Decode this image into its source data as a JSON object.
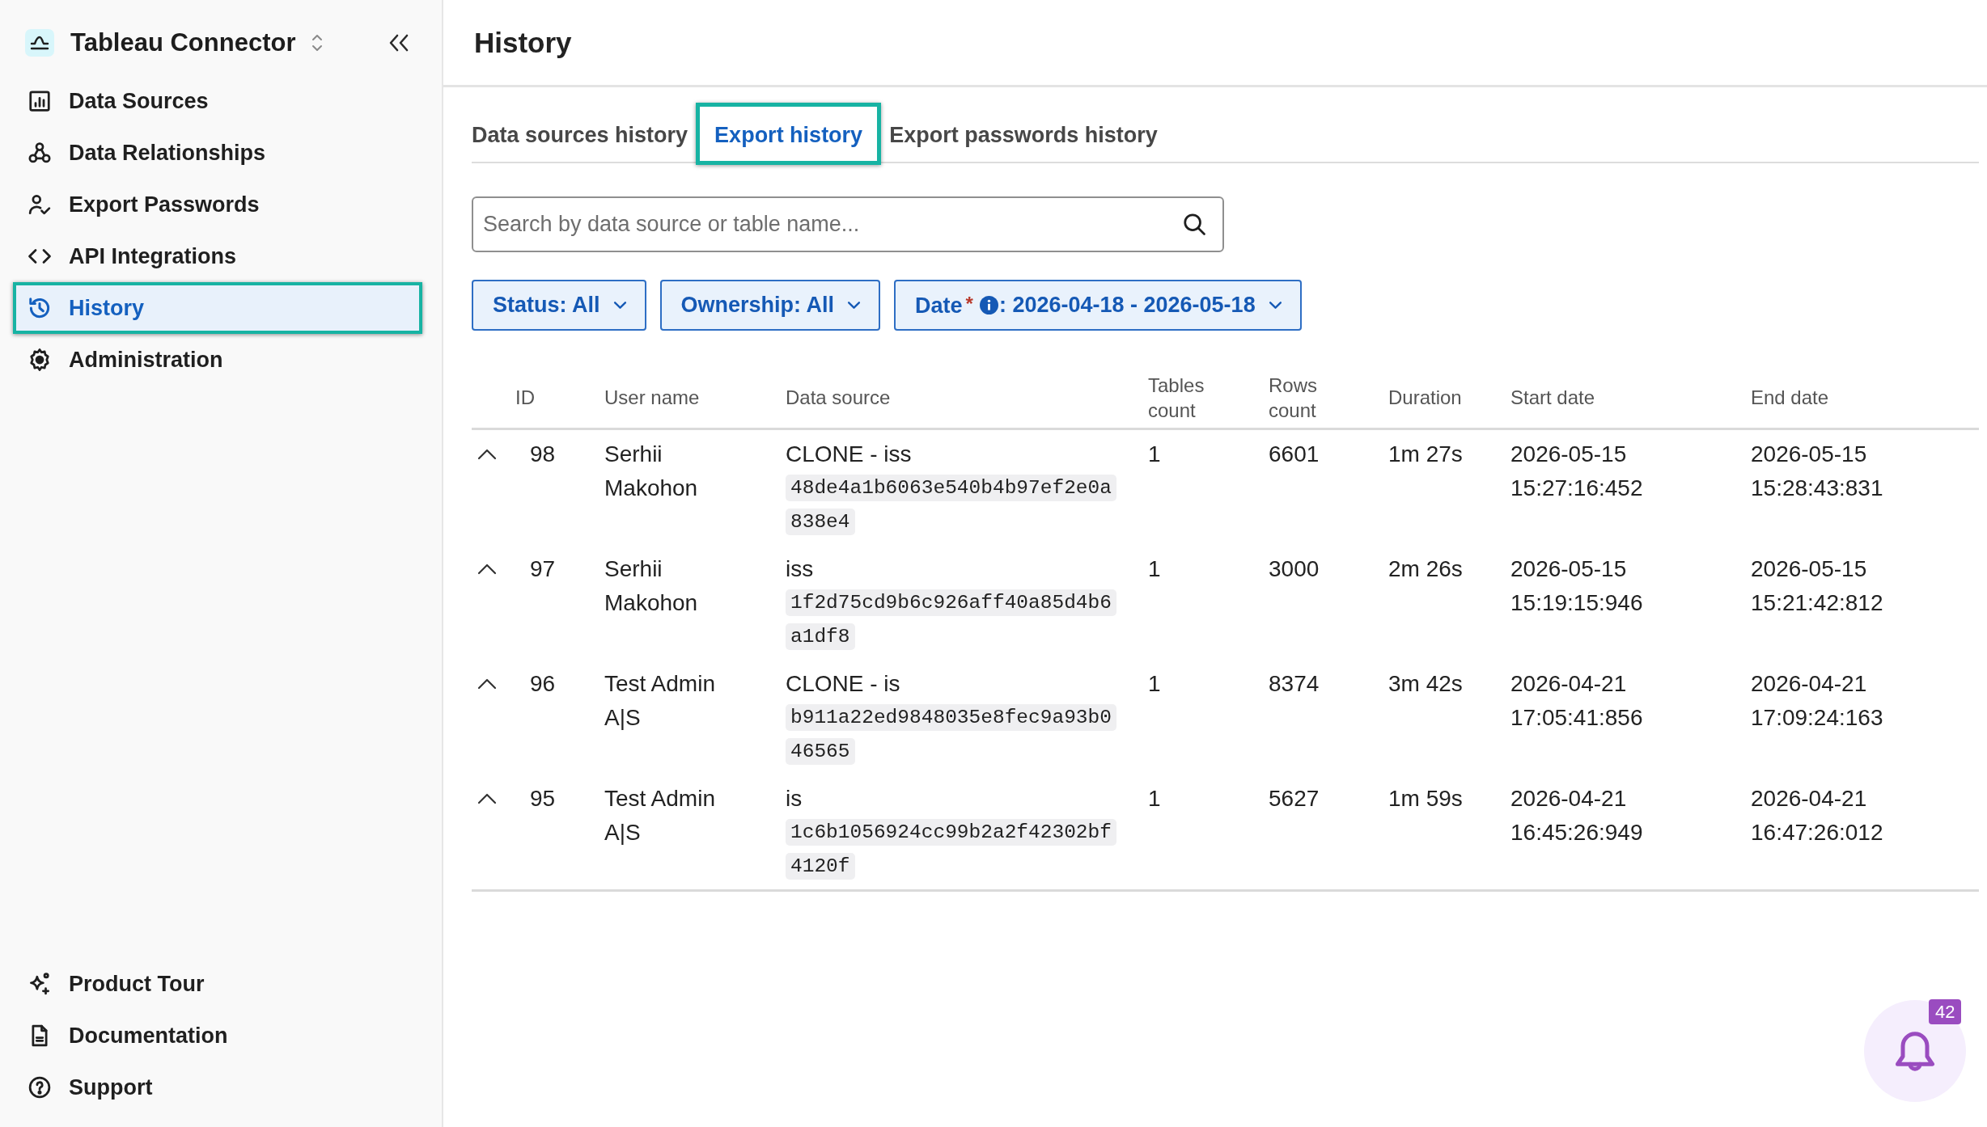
{
  "sidebar": {
    "title": "Tableau Connector",
    "nav": [
      {
        "label": "Data Sources",
        "selected": false
      },
      {
        "label": "Data Relationships",
        "selected": false
      },
      {
        "label": "Export Passwords",
        "selected": false
      },
      {
        "label": "API Integrations",
        "selected": false
      },
      {
        "label": "History",
        "selected": true
      },
      {
        "label": "Administration",
        "selected": false
      }
    ],
    "footer": [
      "Product Tour",
      "Documentation",
      "Support"
    ]
  },
  "page": {
    "title": "History"
  },
  "tabs": [
    {
      "label": "Data sources history",
      "selected": false
    },
    {
      "label": "Export history",
      "selected": true
    },
    {
      "label": "Export passwords history",
      "selected": false
    }
  ],
  "search": {
    "placeholder": "Search by data source or table name..."
  },
  "filters": [
    {
      "label": "Status",
      "info": false,
      "value": ": All"
    },
    {
      "label": "Ownership",
      "info": false,
      "value": ": All"
    },
    {
      "label": "Date",
      "required_mark": "*",
      "info": true,
      "value": ": 2026-04-18 - 2026-05-18"
    }
  ],
  "table": {
    "columns": [
      "ID",
      "User name",
      "Data source",
      "Tables count",
      "Rows count",
      "Duration",
      "Start date",
      "End date"
    ],
    "rows": [
      {
        "expanded": true,
        "id": "98",
        "user": "Serhii Makohon",
        "source": "CLONE - iss",
        "hash": "48de4a1b6063e540b4b97ef2e0a838e4",
        "tables": "1",
        "rows": "6601",
        "duration": "1m 27s",
        "start": "2026-05-15 15:27:16:452",
        "end": "2026-05-15 15:28:43:831"
      },
      {
        "expanded": true,
        "id": "97",
        "user": "Serhii Makohon",
        "source": "iss",
        "hash": "1f2d75cd9b6c926aff40a85d4b6a1df8",
        "tables": "1",
        "rows": "3000",
        "duration": "2m 26s",
        "start": "2026-05-15 15:19:15:946",
        "end": "2026-05-15 15:21:42:812"
      },
      {
        "expanded": true,
        "id": "96",
        "user": "Test Admin A|S",
        "source": "CLONE - is",
        "hash": "b911a22ed9848035e8fec9a93b046565",
        "tables": "1",
        "rows": "8374",
        "duration": "3m 42s",
        "start": "2026-04-21 17:05:41:856",
        "end": "2026-04-21 17:09:24:163"
      },
      {
        "expanded": true,
        "id": "95",
        "user": "Test Admin A|S",
        "source": "is",
        "hash": "1c6b1056924cc99b2a2f42302bf4120f",
        "tables": "1",
        "rows": "5627",
        "duration": "1m 59s",
        "start": "2026-04-21 16:45:26:949",
        "end": "2026-04-21 16:47:26:012"
      }
    ]
  },
  "notifications": {
    "count": "42"
  }
}
